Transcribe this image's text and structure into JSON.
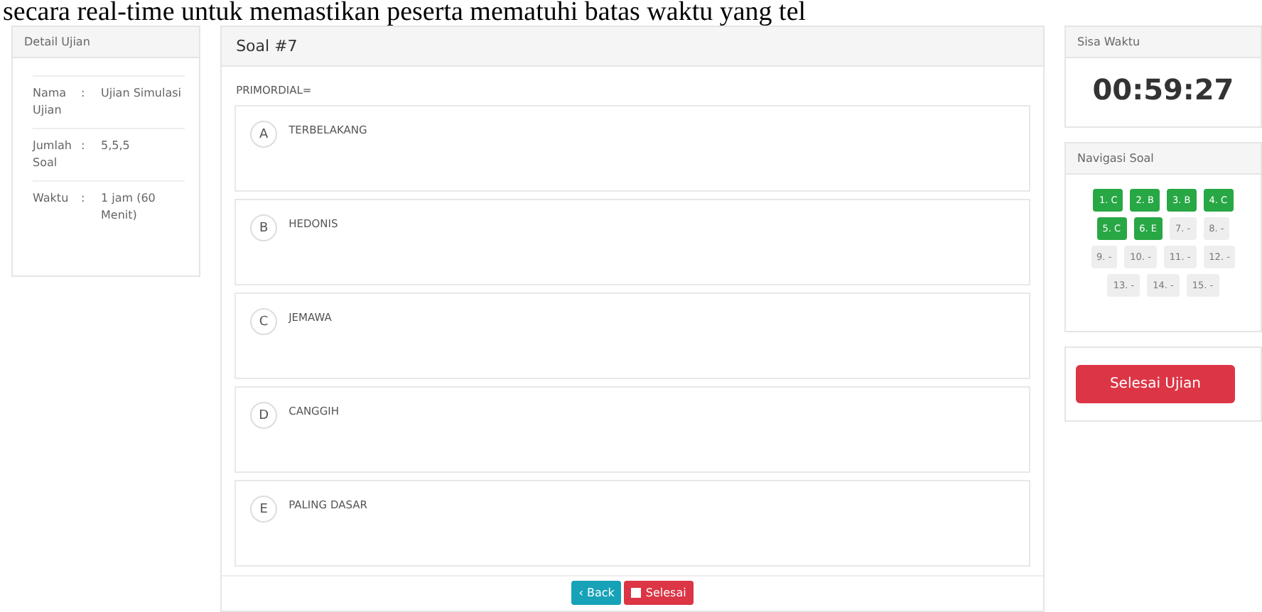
{
  "top_caption": "secara real-time untuk memastikan peserta mematuhi batas waktu yang tel",
  "exam_detail": {
    "title": "Detail Ujian",
    "rows": [
      {
        "label": "Nama Ujian",
        "separator": ":",
        "value": "Ujian Simulasi"
      },
      {
        "label": "Jumlah Soal",
        "separator": ":",
        "value": "5,5,5"
      },
      {
        "label": "Waktu",
        "separator": ":",
        "value": "1 jam (60 Menit)"
      }
    ]
  },
  "question": {
    "title": "Soal #7",
    "text": "PRIMORDIAL=",
    "options": [
      {
        "letter": "A",
        "text": "TERBELAKANG",
        "selected": false
      },
      {
        "letter": "B",
        "text": "HEDONIS",
        "selected": false
      },
      {
        "letter": "C",
        "text": "JEMAWA",
        "selected": false
      },
      {
        "letter": "D",
        "text": "CANGGIH",
        "selected": false
      },
      {
        "letter": "E",
        "text": "PALING DASAR",
        "selected": false
      }
    ],
    "buttons": [
      {
        "kind": "back",
        "label": "‹ Back"
      },
      {
        "kind": "finish",
        "label": "Selesai"
      }
    ]
  },
  "timer": {
    "title": "Sisa Waktu",
    "value": "00:59:27"
  },
  "navigation": {
    "title": "Navigasi Soal",
    "items": [
      {
        "label": "1. C",
        "answered": true
      },
      {
        "label": "2. B",
        "answered": true
      },
      {
        "label": "3. B",
        "answered": true
      },
      {
        "label": "4. C",
        "answered": true
      },
      {
        "label": "5. C",
        "answered": true
      },
      {
        "label": "6. E",
        "answered": true
      },
      {
        "label": "7. -",
        "answered": false
      },
      {
        "label": "8. -",
        "answered": false
      },
      {
        "label": "9. -",
        "answered": false
      },
      {
        "label": "10. -",
        "answered": false
      },
      {
        "label": "11. -",
        "answered": false
      },
      {
        "label": "12. -",
        "answered": false
      },
      {
        "label": "13. -",
        "answered": false
      },
      {
        "label": "14. -",
        "answered": false
      },
      {
        "label": "15. -",
        "answered": false
      }
    ]
  },
  "finish_exam_button": "Selesai Ujian"
}
